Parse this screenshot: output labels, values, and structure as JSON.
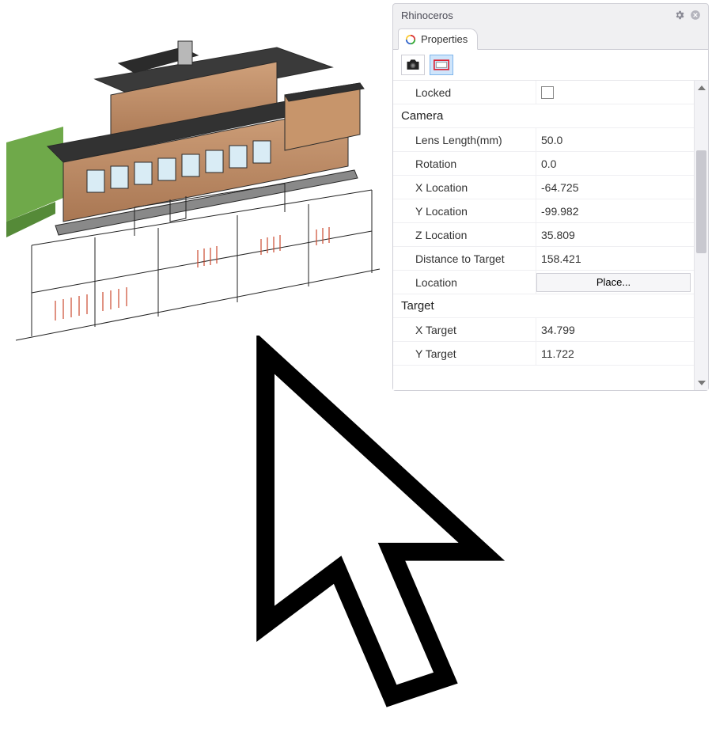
{
  "panel": {
    "title": "Rhinoceros",
    "tab_label": "Properties"
  },
  "locked": {
    "label": "Locked"
  },
  "sections": {
    "camera": "Camera",
    "target": "Target"
  },
  "camera": {
    "lens_label": "Lens Length(mm)",
    "lens_value": "50.0",
    "rotation_label": "Rotation",
    "rotation_value": "0.0",
    "xloc_label": "X Location",
    "xloc_value": "-64.725",
    "yloc_label": "Y Location",
    "yloc_value": "-99.982",
    "zloc_label": "Z Location",
    "zloc_value": "35.809",
    "dist_label": "Distance to Target",
    "dist_value": "158.421",
    "location_label": "Location",
    "place_button": "Place..."
  },
  "target": {
    "x_label": "X Target",
    "x_value": "34.799",
    "y_label": "Y Target",
    "y_value": "11.722"
  }
}
